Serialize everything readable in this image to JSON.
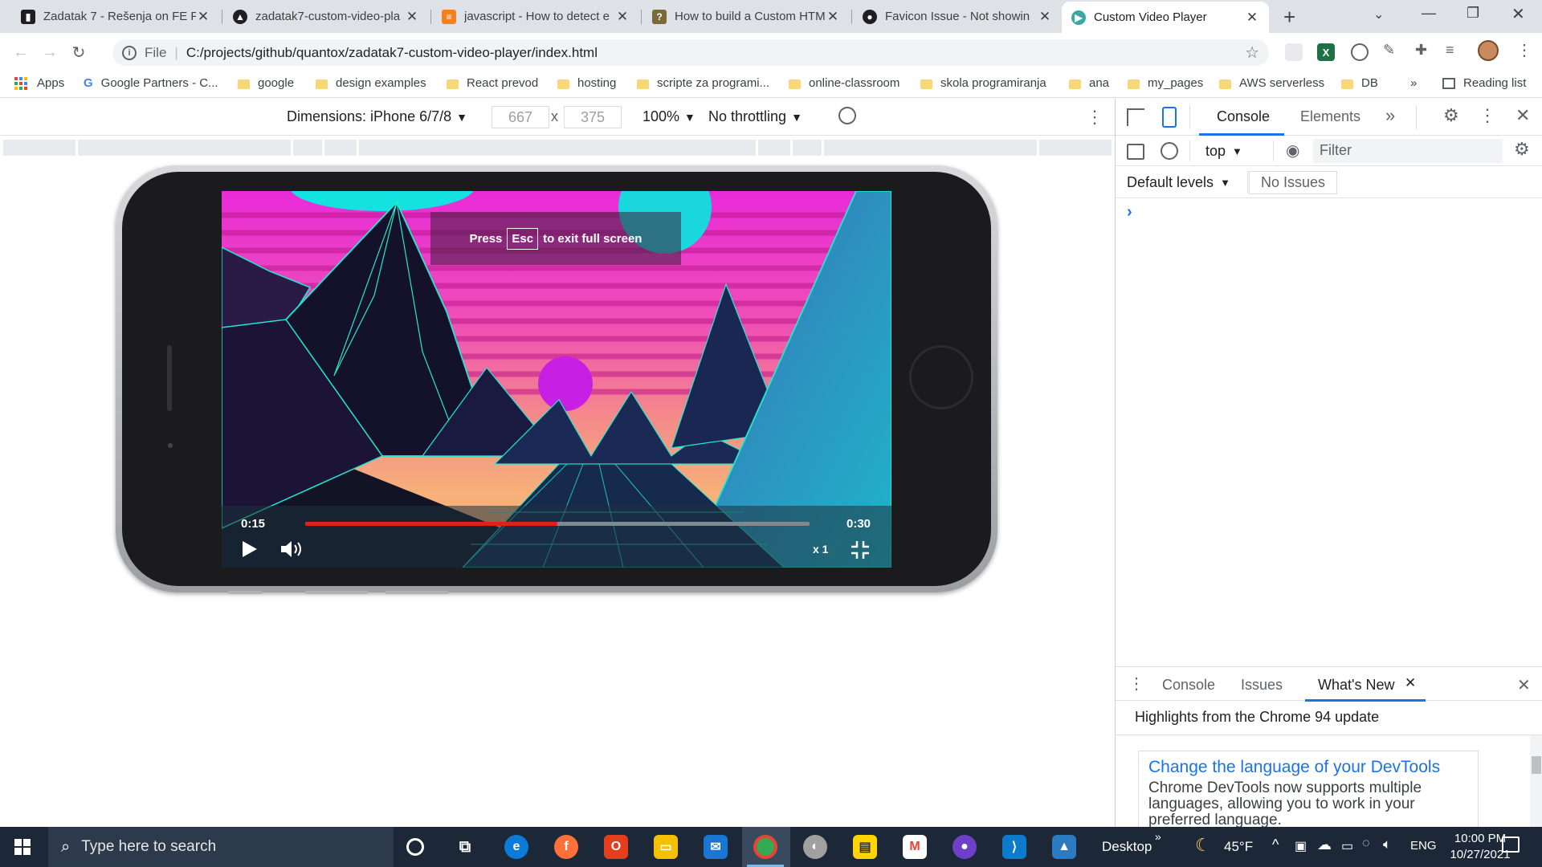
{
  "tabs": [
    {
      "title": "Zadatak 7 - Rešenja on FE P",
      "icon": "trello-icon",
      "color": "#1f1f1f"
    },
    {
      "title": "zadatak7-custom-video-pla",
      "icon": "netlify-icon",
      "color": "#1f1f1f"
    },
    {
      "title": "javascript - How to detect e",
      "icon": "stackoverflow-icon",
      "color": "#f48024"
    },
    {
      "title": "How to build a Custom HTM",
      "icon": "question-icon",
      "color": "#7a6a3a"
    },
    {
      "title": "Favicon Issue - Not showin",
      "icon": "github-icon",
      "color": "#1f1f1f"
    },
    {
      "title": "Custom Video Player",
      "icon": "video-player-icon",
      "color": "#3aa7a7"
    }
  ],
  "omnibox": {
    "scheme": "File",
    "url": "C:/projects/github/quantox/zadatak7-custom-video-player/index.html"
  },
  "bookmarks": [
    {
      "label": "Apps",
      "type": "apps"
    },
    {
      "label": "Google Partners - C...",
      "type": "google"
    },
    {
      "label": "google",
      "type": "folder"
    },
    {
      "label": "design examples",
      "type": "folder"
    },
    {
      "label": "React prevod",
      "type": "folder"
    },
    {
      "label": "hosting",
      "type": "folder"
    },
    {
      "label": "scripte za programi...",
      "type": "folder"
    },
    {
      "label": "online-classroom",
      "type": "folder"
    },
    {
      "label": "skola programiranja",
      "type": "folder"
    },
    {
      "label": "ana",
      "type": "folder"
    },
    {
      "label": "my_pages",
      "type": "folder"
    },
    {
      "label": "AWS serverless",
      "type": "folder"
    },
    {
      "label": "DB",
      "type": "folder"
    }
  ],
  "bookmarks_overflow": "»",
  "reading_list": "Reading list",
  "device_toolbar": {
    "dimensions": "Dimensions: iPhone 6/7/8",
    "width": "667",
    "times": "x",
    "height": "375",
    "zoom": "100%",
    "throttling": "No throttling"
  },
  "video": {
    "fullscreen_hint_press": "Press",
    "fullscreen_hint_key": "Esc",
    "fullscreen_hint_rest": "to exit full screen",
    "current_time": "0:15",
    "duration": "0:30",
    "progress": 0.5,
    "speed": "x 1"
  },
  "devtools": {
    "tabs": [
      "Console",
      "Elements"
    ],
    "active_tab": "Console",
    "context": "top",
    "filter_placeholder": "Filter",
    "levels": "Default levels",
    "issues": "No Issues",
    "prompt": "›",
    "drawer_tabs": [
      "Console",
      "Issues",
      "What's New"
    ],
    "drawer_active": "What's New",
    "whats_new_heading": "Highlights from the Chrome 94 update",
    "card_title": "Change the language of your DevTools",
    "card_body": "Chrome DevTools now supports multiple languages, allowing you to work in your preferred language."
  },
  "taskbar": {
    "search_placeholder": "Type here to search",
    "desktop_label": "Desktop",
    "weather": "45°F",
    "language": "ENG",
    "time": "10:00 PM",
    "date": "10/27/2021"
  },
  "colors": {
    "accent": "#1a73e8",
    "taskbar": "#1c2838",
    "progress": "#e0201a"
  }
}
